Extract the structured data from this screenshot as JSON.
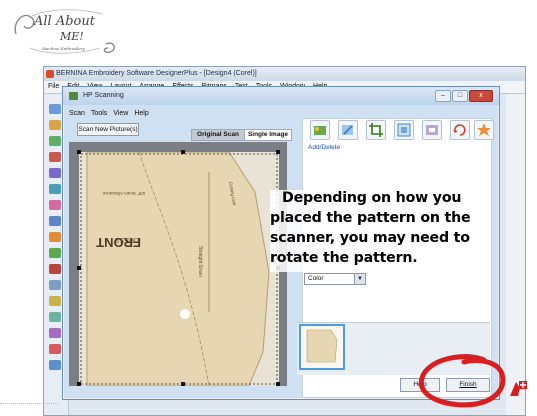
{
  "logo": {
    "line1": "All About",
    "line2": "ME!",
    "tagline": "Machine Embroidery"
  },
  "app": {
    "title": "BERNINA Embroidery Software DesignerPlus - [Design4 (Corel)]",
    "menu": [
      "File",
      "Edit",
      "View",
      "Layout",
      "Arrange",
      "Effects",
      "Bitmaps",
      "Text",
      "Tools",
      "Window",
      "Help"
    ]
  },
  "dialog": {
    "title": "HP Scanning",
    "menu": [
      "Scan",
      "Tools",
      "View",
      "Help"
    ],
    "scan_button": "Scan New Picture(s)",
    "tabs": [
      "Original Scan",
      "Single Image"
    ],
    "add_delete": "Add/Delete",
    "color_select": "Color",
    "help_button": "Help",
    "finish_button": "Finish",
    "window_buttons": [
      "–",
      "□",
      "x"
    ]
  },
  "pattern_text": {
    "front": "FRONT",
    "straight_grain": "Straight Grain",
    "cutting_line": "Cutting Line",
    "seam_line": "5/8\" Seam Allowance"
  },
  "annotation": {
    "lines": [
      "Depending on how you",
      "placed the pattern on the",
      "scanner, you may need to",
      "rotate the pattern."
    ]
  },
  "colors": {
    "annotation_circle": "#d81e1e",
    "dialog_bg": "#cfe0f3",
    "paper": "#e9e3d6",
    "pattern_fill": "#e6d6b2"
  }
}
